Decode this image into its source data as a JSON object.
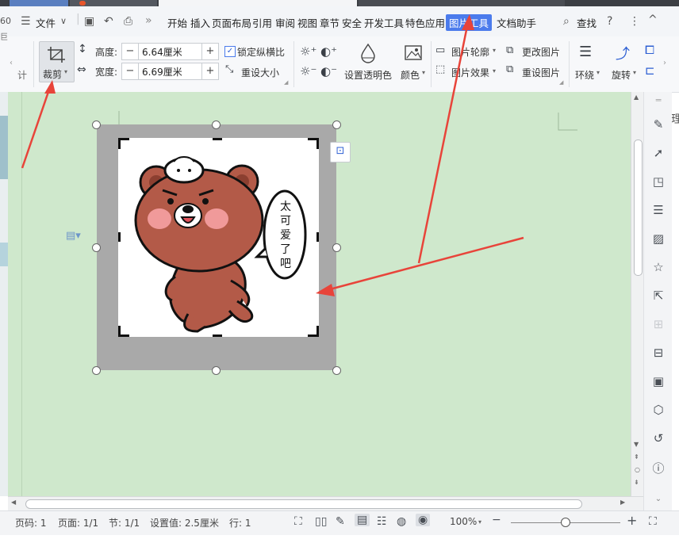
{
  "menu": {
    "file_label": "文件",
    "more_label": "»",
    "tabs": [
      "开始",
      "插入",
      "页面布局",
      "引用",
      "审阅",
      "视图",
      "章节",
      "安全",
      "开发工具",
      "特色应用",
      "图片工具",
      "文档助手"
    ],
    "active_tab": "图片工具",
    "search_label": "查找",
    "help_label": "?",
    "more_vert": "⋮",
    "collapse": "^"
  },
  "ribbon": {
    "crop_label": "裁剪",
    "height_label": "高度:",
    "height_value": "6.64厘米",
    "width_label": "宽度:",
    "width_value": "6.69厘米",
    "lock_ratio_label": "锁定纵横比",
    "lock_ratio_checked": true,
    "reset_size_label": "重设大小",
    "transparent_label": "设置透明色",
    "color_label": "颜色",
    "outline_label": "图片轮廓",
    "effect_label": "图片效果",
    "change_pic_label": "更改图片",
    "reset_pic_label": "重设图片",
    "wrap_label": "环绕",
    "rotate_label": "旋转",
    "minus": "−",
    "plus": "+"
  },
  "picture": {
    "speech_text": "太可爱了吧",
    "speech_chars": [
      "太",
      "可",
      "爱",
      "了",
      "吧"
    ]
  },
  "left_edge_text": [
    "60",
    "巨"
  ],
  "right_edge_text": "理",
  "statusbar": {
    "page_code": "页码: 1",
    "page": "页面: 1/1",
    "section": "节: 1/1",
    "setting": "设置值: 2.5厘米",
    "line": "行: 1",
    "zoom": "100%",
    "zoom_minus": "−",
    "zoom_plus": "+",
    "zoom_level": 0.5
  },
  "colors": {
    "doc_background": "#cfe8cc",
    "active_tab": "#4b7bec",
    "arrow": "#e8443a",
    "bear": "#b35a48"
  }
}
